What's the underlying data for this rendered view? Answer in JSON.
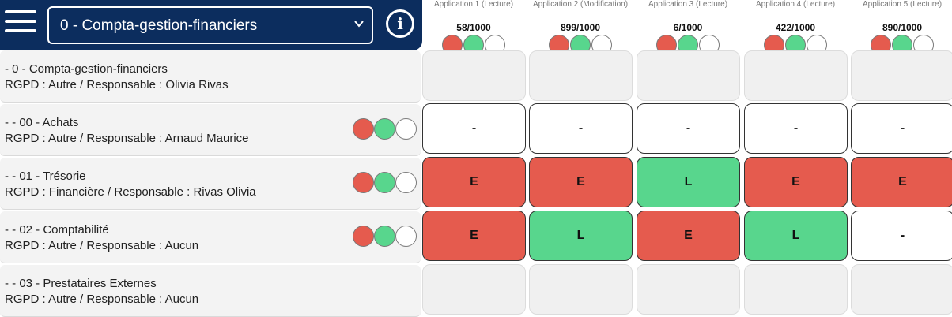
{
  "header": {
    "selector_value": "0 - Compta-gestion-financiers",
    "info_label": "i"
  },
  "columns": [
    {
      "title": "Application 1 (Lecture)",
      "score": "58/1000"
    },
    {
      "title": "Application 2 (Modification)",
      "score": "899/1000"
    },
    {
      "title": "Application 3 (Lecture)",
      "score": "6/1000"
    },
    {
      "title": "Application 4 (Lecture)",
      "score": "422/1000"
    },
    {
      "title": "Application 5 (Lecture)",
      "score": "890/1000"
    }
  ],
  "rows": [
    {
      "line1": "- 0 - Compta-gestion-financiers",
      "line2": "RGPD : Autre / Responsable : Olivia Rivas",
      "cells": [
        "",
        "",
        "",
        "",
        ""
      ]
    },
    {
      "line1": "- - 00 - Achats",
      "line2": "RGPD : Autre / Responsable : Arnaud Maurice",
      "cells": [
        "-",
        "-",
        "-",
        "-",
        "-"
      ]
    },
    {
      "line1": "- - 01 - Trésorie",
      "line2": "RGPD : Financière / Responsable : Rivas Olivia",
      "cells": [
        "E",
        "E",
        "L",
        "E",
        "E"
      ]
    },
    {
      "line1": "- - 02 - Comptabilité",
      "line2": "RGPD : Autre / Responsable : Aucun",
      "cells": [
        "E",
        "L",
        "E",
        "L",
        "-"
      ]
    },
    {
      "line1": "- - 03 - Prestataires Externes",
      "line2": "RGPD : Autre / Responsable : Aucun",
      "cells": [
        "",
        "",
        "",
        "",
        ""
      ]
    }
  ],
  "icons": {
    "menu": "hamburger-icon",
    "dropdown": "chevron-down-icon",
    "info": "info-icon",
    "permission_toggle": "permission-toggle-icon"
  },
  "colors": {
    "header_bg": "#0c2d5e",
    "edit": "#e55b4e",
    "read": "#58d68d",
    "none": "#ffffff"
  }
}
